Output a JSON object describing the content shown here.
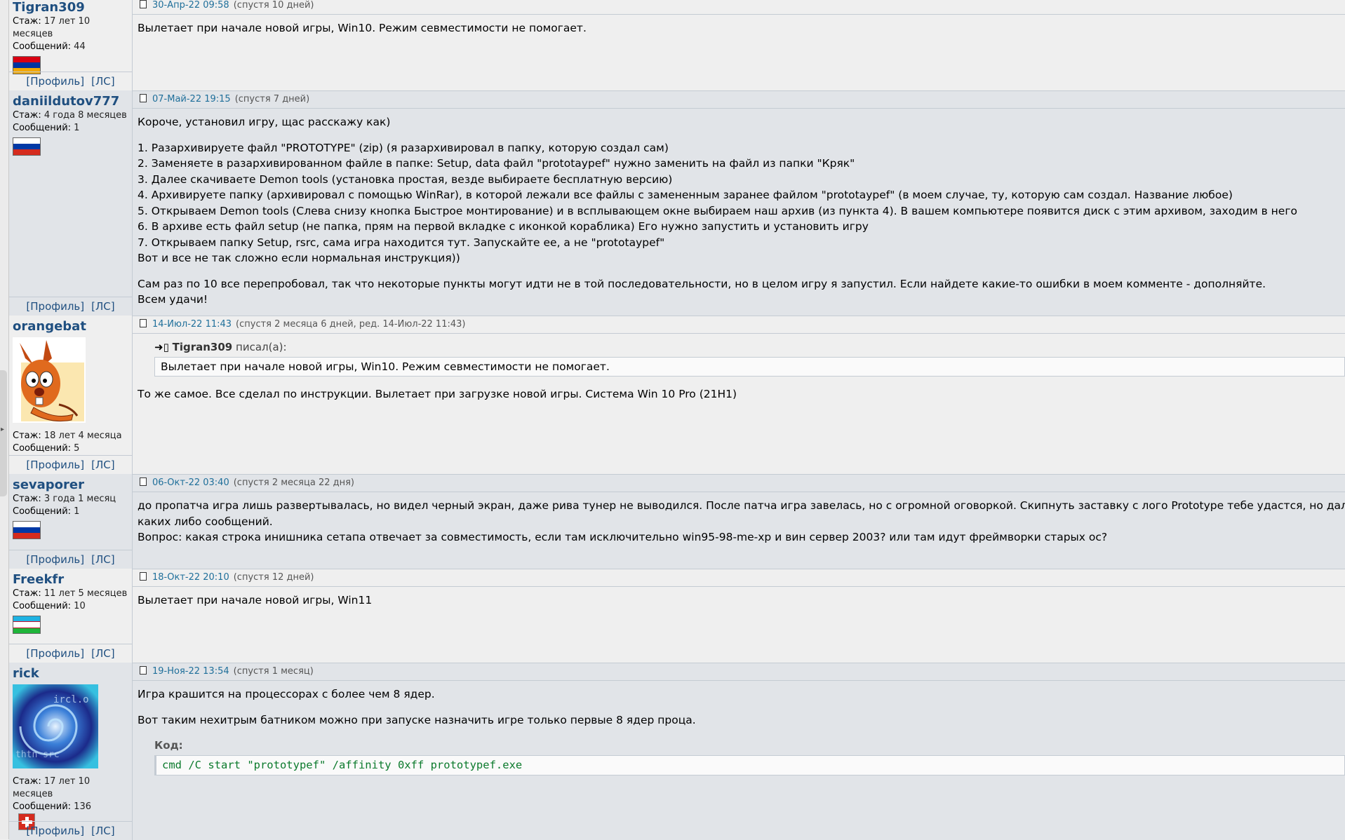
{
  "labels": {
    "tenure": "Стаж:",
    "messages": "Сообщений:",
    "profile": "[Профиль]",
    "pm": "[ЛС]",
    "wrote": "писал(а):",
    "code": "Код:"
  },
  "posts": [
    {
      "nick": "Tigran309",
      "tenure": "17 лет 10 месяцев",
      "messages": "44",
      "flag": "armenia-flag",
      "date": "30-Апр-22 09:58",
      "after": "(спустя 10 дней)",
      "text": "Вылетает при начале новой игры, Win10. Режим севместимости не помогает."
    },
    {
      "nick": "daniildutov777",
      "tenure": "4 года 8 месяцев",
      "messages": "1",
      "flag": "russia-flag",
      "date": "07-Май-22 19:15",
      "after": "(спустя 7 дней)",
      "intro": "Короче, установил игру, щас расскажу как)",
      "steps": [
        "1. Разархивируете файл \"PROTOTYPE\" (zip) (я разархивировал в папку, которую создал сам)",
        "2. Заменяете в разархивированном файле в папке: Setup, data файл \"prototaypef\" нужно заменить на файл из папки \"Кряк\"",
        "3. Далее скачиваете Demon tools (установка простая, везде выбираете бесплатную версию)",
        "4. Архивируете папку (архивировал с помощью WinRar), в которой лежали все файлы с замененным заранее файлом \"prototaypef\" (в моем случае, ту, которую сам создал. Название любое)",
        "5. Открываем Demon tools (Слева снизу кнопка Быстрое монтирование) и в всплывающем окне выбираем наш архив (из пункта 4). В вашем компьютере появится диск с этим архивом, заходим в него",
        "6. В архиве есть файл setup (не папка, прям на первой вкладке с иконкой кораблика) Его нужно запустить и установить игру",
        "7. Открываем папку Setup, rsrc, сама игра находится тут. Запускайте ее, а не \"prototaypef\"",
        "Вот и все не так сложно если нормальная инструкция))"
      ],
      "outro1": "Сам раз по 10 все перепробовал, так что некоторые пункты могут идти не в той последовательности, но в целом игру я запустил. Если найдете какие-то ошибки в моем комменте - дополняйте.",
      "outro2": "Всем удачи!"
    },
    {
      "nick": "orangebat",
      "tenure": "18 лет 4 месяца",
      "messages": "5",
      "date": "14-Июл-22 11:43",
      "after": "(спустя 2 месяца 6 дней, ред. 14-Июл-22 11:43)",
      "quote_author": "Tigran309",
      "quote_text": "Вылетает при начале новой игры, Win10. Режим севместимости не помогает.",
      "text": "То же самое. Все сделал по инструкции. Вылетает при загрузке новой игры. Система Win 10 Pro (21H1)"
    },
    {
      "nick": "sevaporer",
      "tenure": "3 года 1 месяц",
      "messages": "1",
      "flag": "russia-flag",
      "date": "06-Окт-22 03:40",
      "after": "(спустя 2 месяца 22 дня)",
      "line1": "до пропатча игра лишь развертывалась, но видел черный экран, даже рива тунер не выводился. После патча игра завелась, но с огромной оговоркой. Скипнуть заставку с лого Prototype тебе удастся, но дальше сиди",
      "line2": "каких либо сообщений.",
      "line3": "Вопрос: какая строка инишника сетапа отвечает за совместимость, если там исключительно win95-98-me-xp и вин сервер 2003? или там идут фреймворки старых ос?"
    },
    {
      "nick": "Freekfr",
      "tenure": "11 лет 5 месяцев",
      "messages": "10",
      "flag": "uzbekistan-flag",
      "date": "18-Окт-22 20:10",
      "after": "(спустя 12 дней)",
      "text": "Вылетает при начале новой игры, Win11"
    },
    {
      "nick": "rick",
      "tenure": "17 лет 10 месяцев",
      "messages": "136",
      "flag": "switzerland-flag",
      "date": "19-Ноя-22 13:54",
      "after": "(спустя 1 месяц)",
      "text1": "Игра крашится на процессорах с более чем 8 ядер.",
      "text2": "Вот таким нехитрым батником можно при запуске назначить игре только первые 8 ядер проца.",
      "code": "cmd /C start \"prototypef\" /affinity 0xff prototypef.exe"
    }
  ]
}
